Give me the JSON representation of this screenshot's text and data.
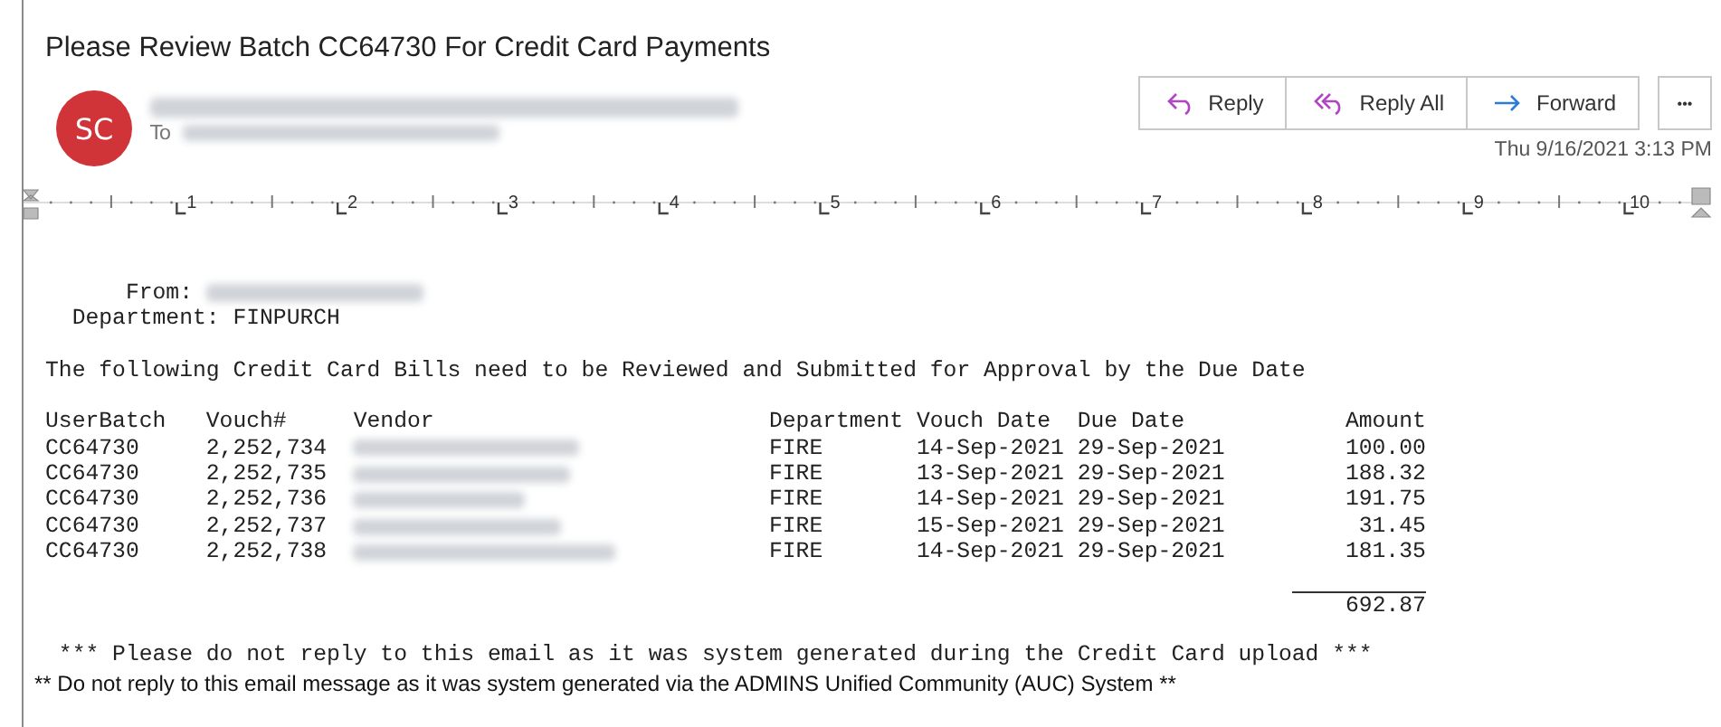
{
  "subject": "Please Review Batch CC64730 For Credit Card Payments",
  "sender": {
    "initials": "SC",
    "to_label": "To"
  },
  "actions": [
    {
      "label": "Reply",
      "kind": "reply"
    },
    {
      "label": "Reply All",
      "kind": "replyall"
    },
    {
      "label": "Forward",
      "kind": "forward"
    }
  ],
  "more_label": "•••",
  "date": "Thu 9/16/2021 3:13 PM",
  "ruler": {
    "numbers": [
      "1",
      "2",
      "3",
      "4",
      "5",
      "6",
      "7",
      "8",
      "9",
      "10"
    ]
  },
  "body": {
    "from_label": "From:",
    "department_label": "Department:",
    "department": "FINPURCH",
    "intro": "The following Credit Card Bills need to be Reviewed and Submitted for Approval by the Due Date",
    "columns": [
      "UserBatch",
      "Vouch#",
      "Vendor",
      "Department",
      "Vouch Date",
      "Due Date",
      "Amount"
    ],
    "rows": [
      [
        "CC64730",
        "2,252,734",
        "",
        "FIRE",
        "14-Sep-2021",
        "29-Sep-2021",
        "100.00"
      ],
      [
        "CC64730",
        "2,252,735",
        "",
        "FIRE",
        "13-Sep-2021",
        "29-Sep-2021",
        "188.32"
      ],
      [
        "CC64730",
        "2,252,736",
        "",
        "FIRE",
        "14-Sep-2021",
        "29-Sep-2021",
        "191.75"
      ],
      [
        "CC64730",
        "2,252,737",
        "",
        "FIRE",
        "15-Sep-2021",
        "29-Sep-2021",
        "31.45"
      ],
      [
        "CC64730",
        "2,252,738",
        "",
        "FIRE",
        "14-Sep-2021",
        "29-Sep-2021",
        "181.35"
      ]
    ],
    "total": "692.87",
    "notice": "*** Please do not reply to this email as it was system generated during the Credit Card upload ***",
    "footer": "** Do not reply to this email message as it was system generated via the ADMINS Unified Community (AUC) System **"
  }
}
